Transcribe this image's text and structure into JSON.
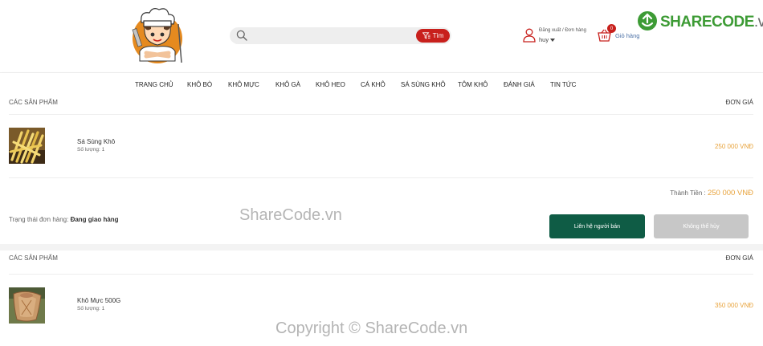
{
  "header": {
    "search_placeholder": "",
    "search_button": "Tìm",
    "account_links": "Đăng xuất / Đơn hàng",
    "account_name": "huy",
    "cart_count": "0",
    "cart_label": "Giỏ hàng"
  },
  "brand": {
    "share": "SHARECODE",
    "vn": ".vn"
  },
  "nav": [
    "TRANG CHỦ",
    "KHÔ BÒ",
    "KHÔ MỰC",
    "KHÔ GÀ",
    "KHÔ HEO",
    "CÁ KHÔ",
    "SÁ SÙNG KHÔ",
    "TÔM KHÔ",
    "ĐÁNH GIÁ",
    "TIN TỨC"
  ],
  "orders": [
    {
      "section_title": "CÁC SẢN PHẨM",
      "price_header": "ĐƠN GIÁ",
      "item_name": "Sá Sùng Khô",
      "item_qty": "Số lượng: 1",
      "item_price": "250 000 VNĐ",
      "total_label": "Thành Tiền : ",
      "total_amount": "250 000 VNĐ",
      "status_label": "Trạng thái đơn hàng: ",
      "status_value": "Đang giao hàng",
      "contact_button": "Liên hệ người bán",
      "cancel_button": "Không thể hủy"
    },
    {
      "section_title": "CÁC SẢN PHẨM",
      "price_header": "ĐƠN GIÁ",
      "item_name": "Khô Mực 500G",
      "item_qty": "Số lượng: 1",
      "item_price": "350 000 VNĐ"
    }
  ],
  "watermarks": {
    "middle": "ShareCode.vn",
    "bottom": "Copyright © ShareCode.vn"
  },
  "colors": {
    "accent_red": "#c8201c",
    "price_orange": "#e8a33c",
    "contact_green": "#0f5c45",
    "brand_green": "#3d9b35"
  }
}
